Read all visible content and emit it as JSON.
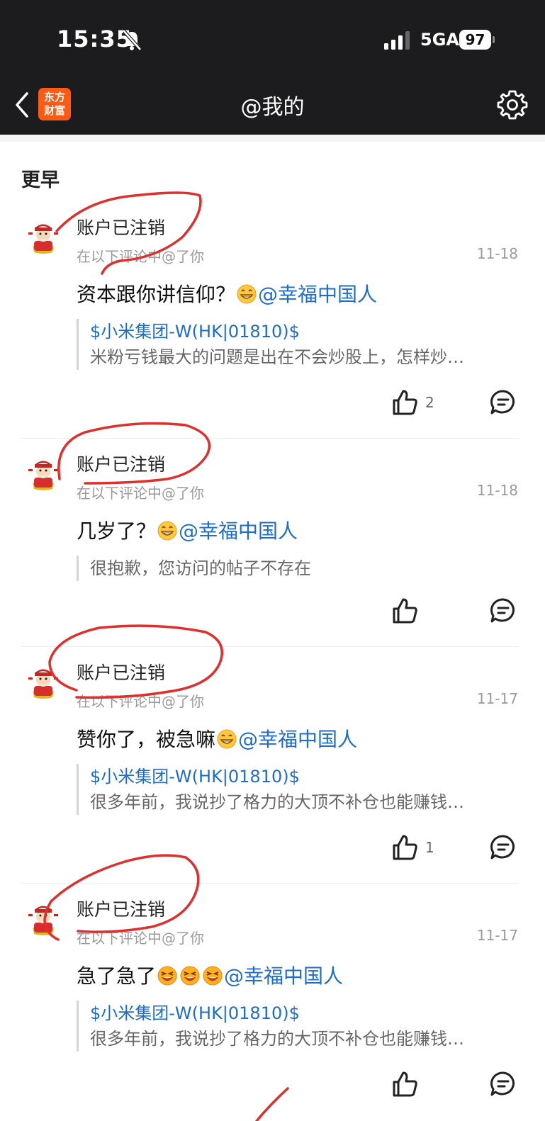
{
  "status_bar": {
    "time": "15:35",
    "network": "5GA",
    "battery": "97"
  },
  "nav": {
    "title": "@我的",
    "logo_line1": "东方",
    "logo_line2": "财富"
  },
  "section_title": "更早",
  "items": [
    {
      "username": "账户已注销",
      "subline": "在以下评论中@了你",
      "date": "11-18",
      "message": "资本跟你讲信仰？",
      "mention": "@幸福中国人",
      "quote_link": "$小米集团-W(HK|01810)$",
      "quote_text": "米粉亏钱最大的问题是出在不会炒股上，怎样炒…",
      "likes": "2"
    },
    {
      "username": "账户已注销",
      "subline": "在以下评论中@了你",
      "date": "11-18",
      "message": "几岁了？",
      "mention": "@幸福中国人",
      "quote_text": "很抱歉，您访问的帖子不存在"
    },
    {
      "username": "账户已注销",
      "subline": "在以下评论中@了你",
      "date": "11-17",
      "message": "赞你了，被急嘛",
      "mention": "@幸福中国人",
      "quote_link": "$小米集团-W(HK|01810)$",
      "quote_text": "很多年前，我说抄了格力的大顶不补仓也能赚钱…",
      "likes": "1"
    },
    {
      "username": "账户已注销",
      "subline": "在以下评论中@了你",
      "date": "11-17",
      "message": "急了急了",
      "mention": "@幸福中国人",
      "quote_link": "$小米集团-W(HK|01810)$",
      "quote_text": "很多年前，我说抄了格力的大顶不补仓也能赚钱…"
    }
  ],
  "icons": {
    "back": "chevron-left-icon",
    "settings": "gear-icon",
    "like": "thumbs-up-icon",
    "comment": "comment-bubble-icon",
    "emoji": "grinning-face-icon",
    "avatar": "fortune-god-avatar-icon"
  },
  "colors": {
    "accent_link": "#1e6ec8",
    "logo_bg": "#ff5a14",
    "annotation": "#e0302e"
  }
}
